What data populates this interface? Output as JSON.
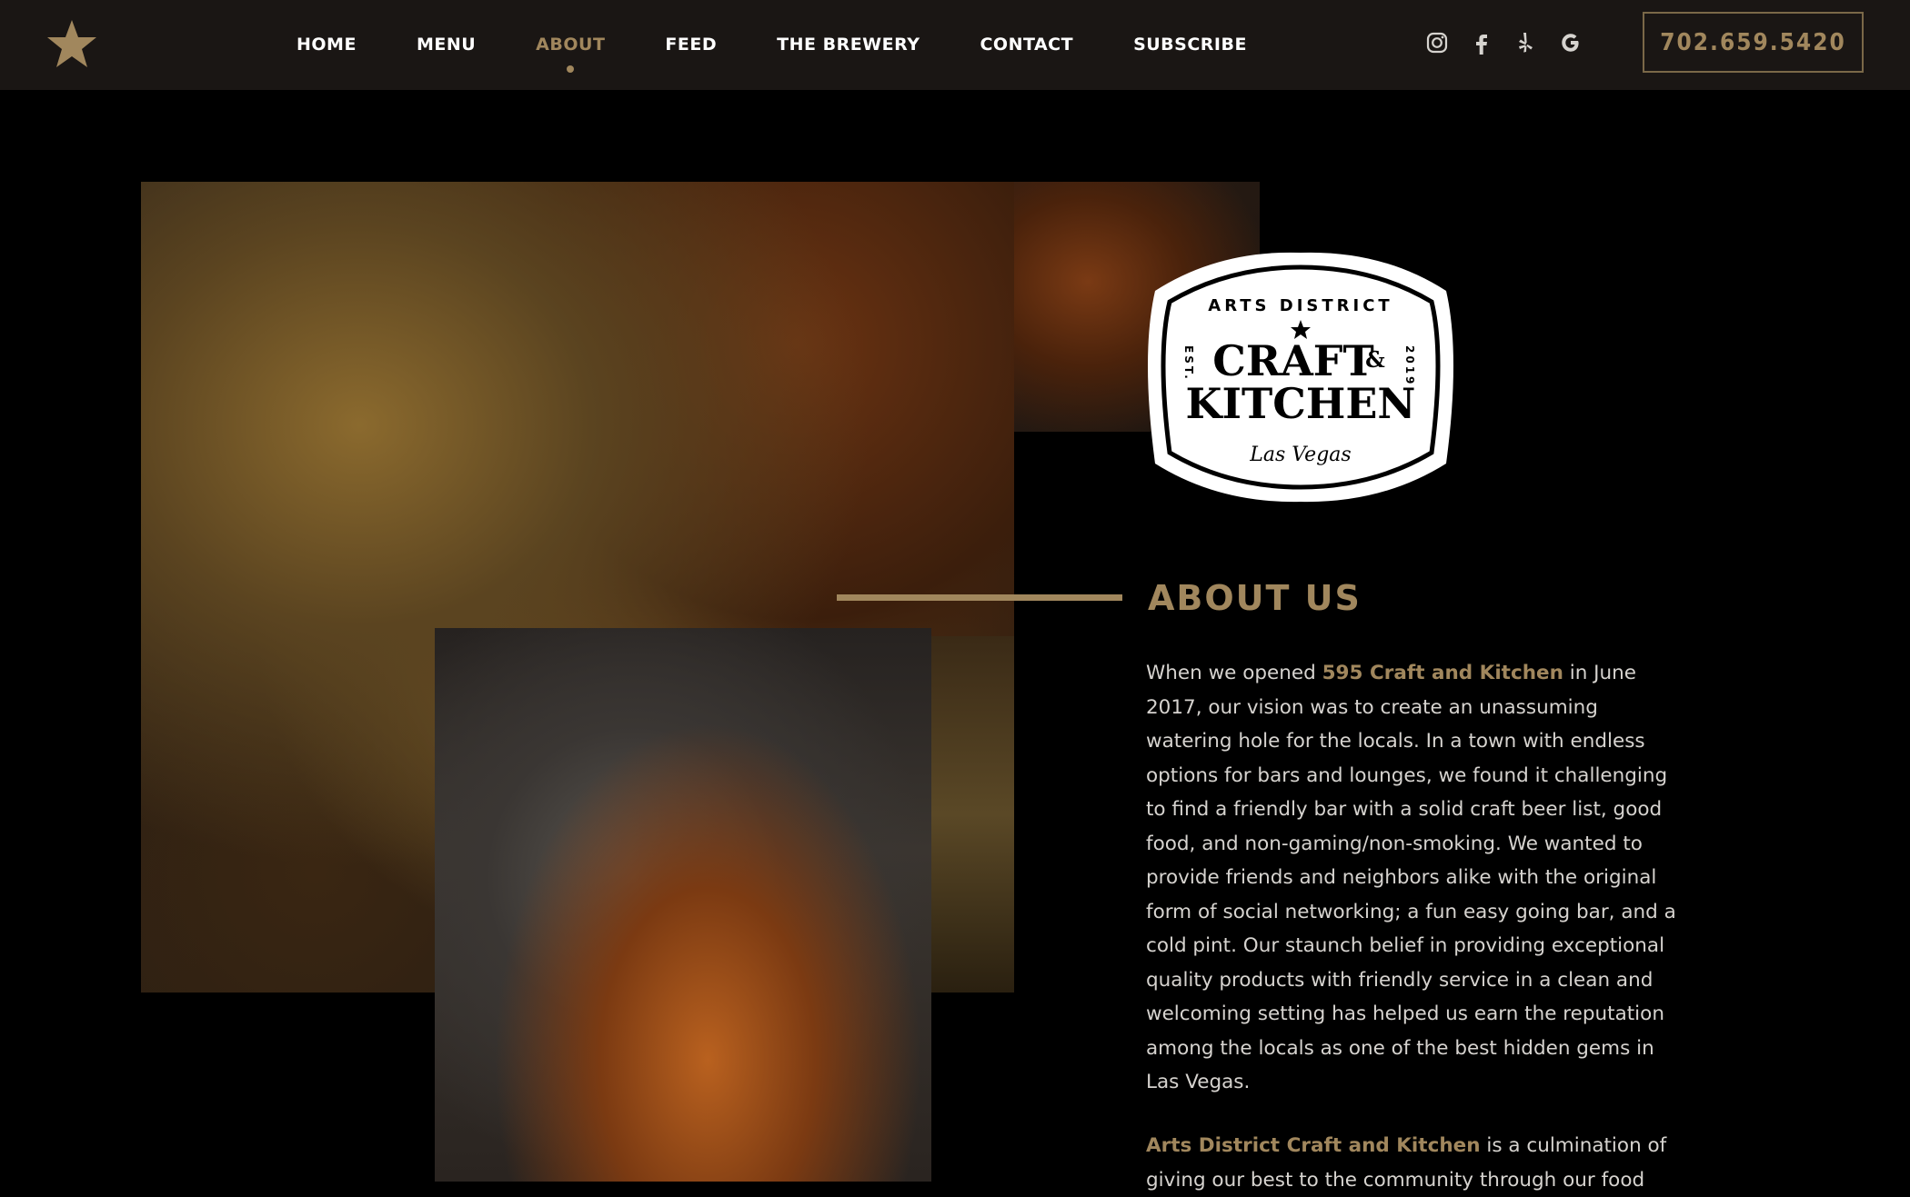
{
  "nav": {
    "items": [
      {
        "label": "HOME",
        "active": false
      },
      {
        "label": "MENU",
        "active": false
      },
      {
        "label": "ABOUT",
        "active": true
      },
      {
        "label": "FEED",
        "active": false
      },
      {
        "label": "THE BREWERY",
        "active": false
      },
      {
        "label": "CONTACT",
        "active": false
      },
      {
        "label": "SUBSCRIBE",
        "active": false
      }
    ],
    "social_icons": [
      "instagram-icon",
      "facebook-icon",
      "yelp-icon",
      "google-icon"
    ],
    "phone": "702.659.5420"
  },
  "badge": {
    "top_text": "ARTS DISTRICT",
    "line1": "CRAFT",
    "amp": "&",
    "line2": "KITCHEN",
    "left_text": "EST.",
    "right_text": "2019",
    "bottom_text": "Las Vegas"
  },
  "about": {
    "title": "ABOUT US",
    "p1_pre": "When we opened ",
    "p1_highlight": "595 Craft and Kitchen",
    "p1_post": " in June 2017, our vision was to create an unassuming watering hole for the locals. In a town with endless options for bars and lounges, we found it challenging to find a friendly bar with a solid craft beer list, good food, and non-gaming/non-smoking. We wanted to provide friends and neighbors alike with the original form of social networking; a fun easy going bar, and a cold pint. Our staunch belief in providing exceptional quality products with friendly service in a clean and welcoming setting has helped us earn the reputation among the locals as one of the best hidden gems in Las Vegas.",
    "p2_highlight": "Arts District Craft and Kitchen",
    "p2_post": " is a culmination of giving our best to the community through our food"
  },
  "colors": {
    "accent": "#a1875d",
    "nav_bg": "#1a1614",
    "page_bg": "#000000",
    "body_text": "#d6d3cf"
  }
}
